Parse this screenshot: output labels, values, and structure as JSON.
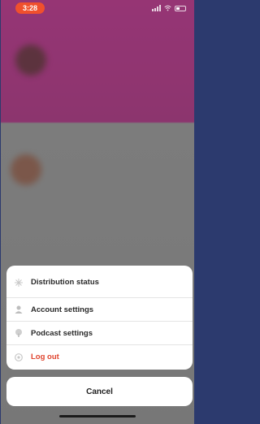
{
  "status_bar": {
    "time": "3:28",
    "icons": [
      "signal-icon",
      "wifi-icon",
      "battery-icon"
    ]
  },
  "action_sheet": {
    "items": [
      {
        "label": "Distribution status",
        "icon": "sparkle-icon",
        "destructive": false
      },
      {
        "label": "Account settings",
        "icon": "person-icon",
        "destructive": false
      },
      {
        "label": "Podcast settings",
        "icon": "podcast-icon",
        "destructive": false
      },
      {
        "label": "Log out",
        "icon": "logout-icon",
        "destructive": true
      }
    ],
    "cancel_label": "Cancel"
  },
  "colors": {
    "accent": "#f0502d",
    "destructive": "#e0442e",
    "background_top": "#9a2c74"
  }
}
